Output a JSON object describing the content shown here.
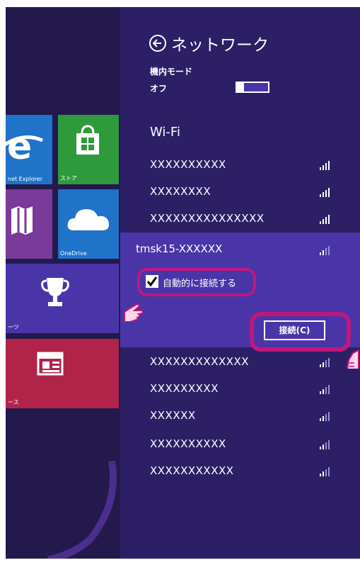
{
  "start_tiles": {
    "ie_label": "net Explorer",
    "store_label": "ストア",
    "onedrive_label": "OneDrive",
    "sports_label": "ーツ",
    "news_label": "ース"
  },
  "panel": {
    "title": "ネットワーク",
    "airplane_label": "機内モード",
    "airplane_state": "オフ",
    "wifi_heading": "Wi-Fi",
    "networks_top": [
      {
        "ssid": "XXXXXXXXXX"
      },
      {
        "ssid": "XXXXXXXX"
      },
      {
        "ssid": "XXXXXXXXXXXXXXX"
      }
    ],
    "selected": {
      "ssid": "tmsk15-XXXXXX",
      "auto_connect_label": "自動的に接続する",
      "auto_connect_checked": true,
      "connect_button": "接続(C)"
    },
    "networks_bottom": [
      {
        "ssid": "XXXXXXXXXXXXX"
      },
      {
        "ssid": "XXXXXXXXX"
      },
      {
        "ssid": "XXXXXX"
      },
      {
        "ssid": "XXXXXXXXXX"
      },
      {
        "ssid": "XXXXXXXXXXX"
      }
    ]
  },
  "colors": {
    "panel_bg": "#2c1f66",
    "selected_bg": "#4a35a8",
    "highlight": "#c0177e",
    "tile_blue": "#1f73c8",
    "tile_green": "#2e9a3c",
    "tile_purple": "#7a3a9a",
    "tile_red": "#b0244a"
  }
}
